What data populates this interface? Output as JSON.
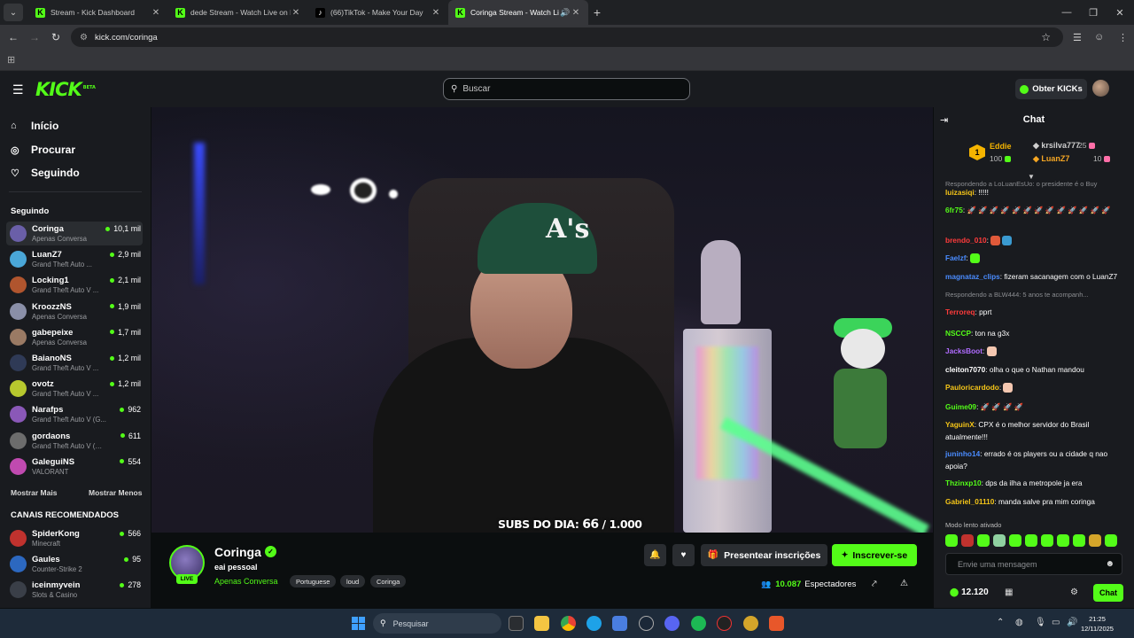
{
  "browser": {
    "tabs": [
      {
        "title": "Stream - Kick Dashboard",
        "favicon": "kick-favicon",
        "active": false
      },
      {
        "title": "dede Stream - Watch Live on K",
        "favicon": "kick-favicon",
        "active": false
      },
      {
        "title": "(66)TikTok - Make Your Day",
        "favicon": "tiktok-favicon",
        "active": false
      },
      {
        "title": "Coringa Stream - Watch Li",
        "favicon": "kick-favicon",
        "active": true
      }
    ],
    "url": "kick.com/coringa"
  },
  "header": {
    "logo_text": "KICK",
    "logo_sup": "BETA",
    "search_placeholder": "Buscar",
    "kicks_button": "Obter KICKs"
  },
  "sidebar": {
    "nav": [
      {
        "label": "Início",
        "icon": "home-icon"
      },
      {
        "label": "Procurar",
        "icon": "compass-icon"
      },
      {
        "label": "Seguindo",
        "icon": "heart-icon"
      }
    ],
    "following_heading": "Seguindo",
    "following": [
      {
        "name": "Coringa",
        "category": "Apenas Conversa",
        "viewers": "10,1 mil",
        "active": true,
        "color": "#6a5fa8"
      },
      {
        "name": "LuanZ7",
        "category": "Grand Theft Auto ...",
        "viewers": "2,9 mil",
        "color": "#4aa7d8"
      },
      {
        "name": "Locking1",
        "category": "Grand Theft Auto V ...",
        "viewers": "2,1 mil",
        "color": "#b0552e"
      },
      {
        "name": "KroozzNS",
        "category": "Apenas Conversa",
        "viewers": "1,9 mil",
        "color": "#8a8fa8"
      },
      {
        "name": "gabepeixe",
        "category": "Apenas Conversa",
        "viewers": "1,7 mil",
        "color": "#9a7a64"
      },
      {
        "name": "BaianoNS",
        "category": "Grand Theft Auto V ...",
        "viewers": "1,2 mil",
        "color": "#2f3a56"
      },
      {
        "name": "ovotz",
        "category": "Grand Theft Auto V ...",
        "viewers": "1,2 mil",
        "color": "#b7c82e"
      },
      {
        "name": "Narafps",
        "category": "Grand Theft Auto V (G...",
        "viewers": "962",
        "color": "#8a58b8"
      },
      {
        "name": "gordaons",
        "category": "Grand Theft Auto V (GT...",
        "viewers": "611",
        "color": "#6c6c6c"
      },
      {
        "name": "GaleguiNS",
        "category": "VALORANT",
        "viewers": "554",
        "color": "#c04ab0"
      }
    ],
    "show_more": "Mostrar Mais",
    "show_less": "Mostrar Menos",
    "recommended_heading": "CANAIS RECOMENDADOS",
    "recommended": [
      {
        "name": "SpiderKong",
        "category": "Minecraft",
        "viewers": "566",
        "color": "#c0322e"
      },
      {
        "name": "Gaules",
        "category": "Counter-Strike 2",
        "viewers": "95",
        "color": "#2c68c0"
      },
      {
        "name": "iceinmyvein",
        "category": "Slots & Casino",
        "viewers": "278",
        "color": "#3a3f48"
      }
    ]
  },
  "video": {
    "overlay_label": "SUBS DO DIA:",
    "overlay_count": "66",
    "overlay_goal": "/ 1.000"
  },
  "stream": {
    "channel": "Coringa",
    "live_label": "LIVE",
    "title": "eai pessoal",
    "category": "Apenas Conversa",
    "tags": [
      "Portuguese",
      "loud",
      "Coringa"
    ],
    "gift_button": "Presentear inscrições",
    "subscribe_button": "Inscrever-se",
    "viewers_count": "10.087",
    "viewers_label": "Espectadores"
  },
  "chat": {
    "title": "Chat",
    "leaderboard": {
      "rank": "1",
      "top_name": "Eddie",
      "top_value": "100",
      "entries": [
        {
          "name": "krsilva777",
          "value": "25",
          "color": "#cfcfcf"
        },
        {
          "name": "LuanZ7",
          "value": "10",
          "color": "#f5a623"
        }
      ]
    },
    "reply_top": "Respondendo a LoLuanEsUo: o presidente é o Buy",
    "messages": [
      {
        "user": "luizasiqi",
        "color": "#f5c518",
        "text": "!!!!!"
      },
      {
        "user": "6fr75",
        "color": "#53fc18",
        "text": "🚀 🚀 🚀 🚀 🚀 🚀 🚀 🚀 🚀 🚀 🚀 🚀 🚀"
      },
      {
        "user": "brendo_010",
        "color": "#ff3b3b",
        "text": ""
      },
      {
        "user": "Faelzf",
        "color": "#4a8cff",
        "text": ""
      },
      {
        "user": "magnataz_clips",
        "color": "#4a8cff",
        "text": "fizeram sacanagem com o LuanZ7"
      },
      {
        "user": "Terroreq",
        "color": "#ff3b3b",
        "text": "pprt"
      },
      {
        "user": "NSCCP",
        "color": "#53fc18",
        "text": "ton na g3x"
      },
      {
        "user": "JacksBoot",
        "color": "#b06cff",
        "text": ""
      },
      {
        "user": "cleiton7070",
        "color": "#ffffff",
        "text": "olha o que o Nathan mandou"
      },
      {
        "user": "Pauloricardodo",
        "color": "#f5c518",
        "text": ""
      },
      {
        "user": "Guime09",
        "color": "#53fc18",
        "text": "🚀 🚀 🚀 🚀"
      },
      {
        "user": "YaguinX",
        "color": "#f5c518",
        "text": "CPX é o melhor servidor do Brasil atualmente!!!"
      },
      {
        "user": "juninho14",
        "color": "#4a8cff",
        "text": "errado é os players ou a cidade q nao apoia?"
      },
      {
        "user": "Thzinxp10",
        "color": "#53fc18",
        "text": "dps da ilha a metropole ja era"
      },
      {
        "user": "Gabriel_01110",
        "color": "#f5c518",
        "text": "manda salve pra mim coringa"
      }
    ],
    "reply_mid": "Respondendo a BLW444: 5 anos te acompanh...",
    "slow_mode": "Modo lento ativado",
    "input_placeholder": "Envie uma mensagem",
    "kicks_balance": "12.120",
    "send_button": "Chat"
  },
  "taskbar": {
    "search_placeholder": "Pesquisar",
    "time": "21:25",
    "date": "12/11/2025"
  },
  "colors": {
    "accent": "#53fc18",
    "background": "#0b0e0f",
    "panel": "#191b1f"
  }
}
